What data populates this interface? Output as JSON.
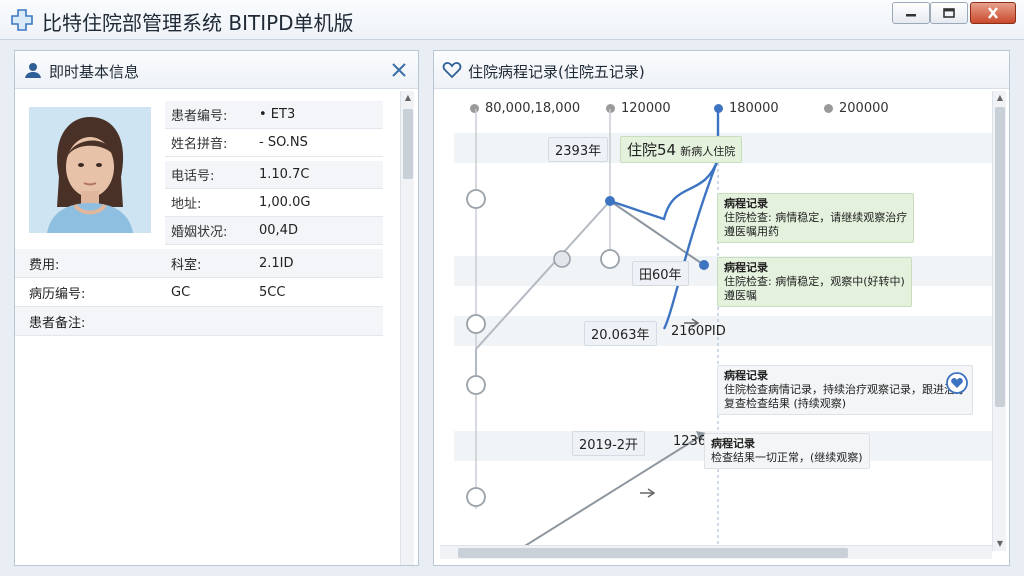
{
  "window": {
    "title": "比特住院部管理系统 BITIPD单机版"
  },
  "left_panel": {
    "title": "即时基本信息",
    "info_rows": [
      {
        "key": "患者编号:",
        "value": "• ET3"
      },
      {
        "key": "姓名拼音:",
        "value": "- SO.NS"
      },
      {
        "key": "电话号:",
        "value": "1.10.7C"
      },
      {
        "key": "地址:",
        "value": "1,00.0G"
      },
      {
        "key": "婚姻状况:",
        "value": "00,4D"
      }
    ],
    "wide_rows": [
      {
        "c1": "费用:",
        "c2": "科室:",
        "c3": "2.1ID"
      },
      {
        "c1": "病历编号:",
        "c2": "GC",
        "c3": "5CC"
      },
      {
        "c1": "患者备注:",
        "c2": "",
        "c3": ""
      }
    ]
  },
  "right_panel": {
    "title": "住院病程记录(住院五记录)",
    "axis_labels": [
      "80,000,18,000",
      "120000",
      "180000",
      "200000"
    ],
    "tags": [
      {
        "id": "t1",
        "text": "2393年"
      },
      {
        "id": "t2",
        "text": "住院54"
      },
      {
        "id": "t3",
        "text": "田60年"
      },
      {
        "id": "t4",
        "text": "20.063年"
      },
      {
        "id": "t5",
        "text": "2160PID"
      },
      {
        "id": "t6",
        "text": "2019-2开"
      },
      {
        "id": "t7",
        "text": "1236"
      }
    ],
    "notes": [
      {
        "id": "n1",
        "head": "病程记录",
        "body": "住院检查: 病情稳定，请继续观察治疗\n遵医嘱用药"
      },
      {
        "id": "n2",
        "head": "病程记录",
        "body": "住院检查: 病情稳定，观察中(好转中)\n遵医嘱"
      },
      {
        "id": "n3",
        "head": "病程记录",
        "body": "住院检查病情记录，持续治疗观察记录，跟进治疗\n复查检查结果 (持续观察)"
      },
      {
        "id": "n4",
        "head": "病程记录",
        "body": "检查结果一切正常，(继续观察)"
      }
    ],
    "note_small": "新病人住院"
  }
}
